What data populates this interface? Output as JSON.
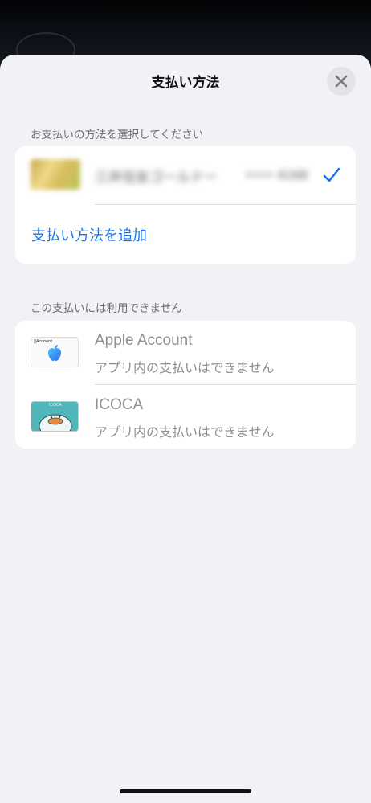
{
  "sheet": {
    "title": "支払い方法",
    "close_icon": "close-icon"
  },
  "select_section": {
    "label": "お支払いの方法を選択してください",
    "selected_card": {
      "name": "三井住友ゴールドー",
      "number": "•••• 4168",
      "check_icon": "checkmark-icon",
      "obscured": true
    },
    "add_link": "支払い方法を追加"
  },
  "unavailable_section": {
    "label": "この支払いには利用できません",
    "items": [
      {
        "title": "Apple Account",
        "subtitle": "アプリ内の支払いはできません",
        "thumb_label": "Account",
        "icon": "apple-logo-icon"
      },
      {
        "title": "ICOCA",
        "subtitle": "アプリ内の支払いはできません",
        "thumb_label": "ICOCA",
        "icon": "icoca-card-icon"
      }
    ]
  },
  "colors": {
    "accent": "#1a73e8",
    "sheet_bg": "#f1f1f6",
    "card_bg": "#ffffff",
    "muted_text": "#8e8e93"
  }
}
